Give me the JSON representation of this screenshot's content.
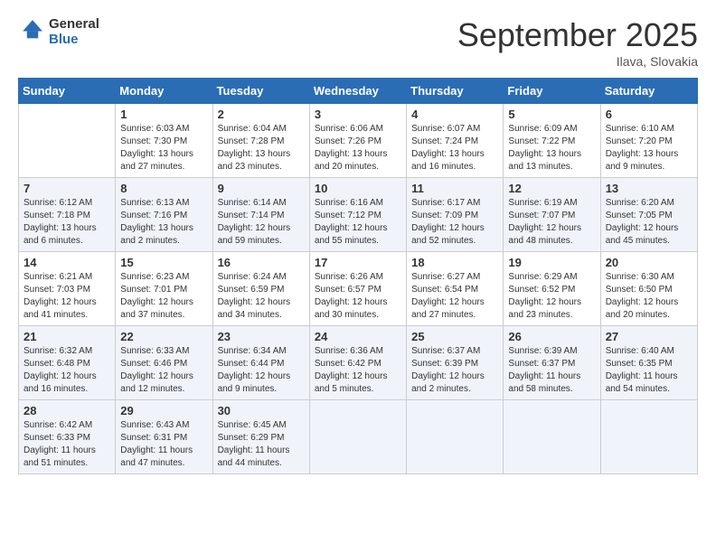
{
  "logo": {
    "text_general": "General",
    "text_blue": "Blue"
  },
  "header": {
    "month": "September 2025",
    "location": "Ilava, Slovakia"
  },
  "weekdays": [
    "Sunday",
    "Monday",
    "Tuesday",
    "Wednesday",
    "Thursday",
    "Friday",
    "Saturday"
  ],
  "weeks": [
    [
      {
        "day": "",
        "sunrise": "",
        "sunset": "",
        "daylight": ""
      },
      {
        "day": "1",
        "sunrise": "Sunrise: 6:03 AM",
        "sunset": "Sunset: 7:30 PM",
        "daylight": "Daylight: 13 hours and 27 minutes."
      },
      {
        "day": "2",
        "sunrise": "Sunrise: 6:04 AM",
        "sunset": "Sunset: 7:28 PM",
        "daylight": "Daylight: 13 hours and 23 minutes."
      },
      {
        "day": "3",
        "sunrise": "Sunrise: 6:06 AM",
        "sunset": "Sunset: 7:26 PM",
        "daylight": "Daylight: 13 hours and 20 minutes."
      },
      {
        "day": "4",
        "sunrise": "Sunrise: 6:07 AM",
        "sunset": "Sunset: 7:24 PM",
        "daylight": "Daylight: 13 hours and 16 minutes."
      },
      {
        "day": "5",
        "sunrise": "Sunrise: 6:09 AM",
        "sunset": "Sunset: 7:22 PM",
        "daylight": "Daylight: 13 hours and 13 minutes."
      },
      {
        "day": "6",
        "sunrise": "Sunrise: 6:10 AM",
        "sunset": "Sunset: 7:20 PM",
        "daylight": "Daylight: 13 hours and 9 minutes."
      }
    ],
    [
      {
        "day": "7",
        "sunrise": "Sunrise: 6:12 AM",
        "sunset": "Sunset: 7:18 PM",
        "daylight": "Daylight: 13 hours and 6 minutes."
      },
      {
        "day": "8",
        "sunrise": "Sunrise: 6:13 AM",
        "sunset": "Sunset: 7:16 PM",
        "daylight": "Daylight: 13 hours and 2 minutes."
      },
      {
        "day": "9",
        "sunrise": "Sunrise: 6:14 AM",
        "sunset": "Sunset: 7:14 PM",
        "daylight": "Daylight: 12 hours and 59 minutes."
      },
      {
        "day": "10",
        "sunrise": "Sunrise: 6:16 AM",
        "sunset": "Sunset: 7:12 PM",
        "daylight": "Daylight: 12 hours and 55 minutes."
      },
      {
        "day": "11",
        "sunrise": "Sunrise: 6:17 AM",
        "sunset": "Sunset: 7:09 PM",
        "daylight": "Daylight: 12 hours and 52 minutes."
      },
      {
        "day": "12",
        "sunrise": "Sunrise: 6:19 AM",
        "sunset": "Sunset: 7:07 PM",
        "daylight": "Daylight: 12 hours and 48 minutes."
      },
      {
        "day": "13",
        "sunrise": "Sunrise: 6:20 AM",
        "sunset": "Sunset: 7:05 PM",
        "daylight": "Daylight: 12 hours and 45 minutes."
      }
    ],
    [
      {
        "day": "14",
        "sunrise": "Sunrise: 6:21 AM",
        "sunset": "Sunset: 7:03 PM",
        "daylight": "Daylight: 12 hours and 41 minutes."
      },
      {
        "day": "15",
        "sunrise": "Sunrise: 6:23 AM",
        "sunset": "Sunset: 7:01 PM",
        "daylight": "Daylight: 12 hours and 37 minutes."
      },
      {
        "day": "16",
        "sunrise": "Sunrise: 6:24 AM",
        "sunset": "Sunset: 6:59 PM",
        "daylight": "Daylight: 12 hours and 34 minutes."
      },
      {
        "day": "17",
        "sunrise": "Sunrise: 6:26 AM",
        "sunset": "Sunset: 6:57 PM",
        "daylight": "Daylight: 12 hours and 30 minutes."
      },
      {
        "day": "18",
        "sunrise": "Sunrise: 6:27 AM",
        "sunset": "Sunset: 6:54 PM",
        "daylight": "Daylight: 12 hours and 27 minutes."
      },
      {
        "day": "19",
        "sunrise": "Sunrise: 6:29 AM",
        "sunset": "Sunset: 6:52 PM",
        "daylight": "Daylight: 12 hours and 23 minutes."
      },
      {
        "day": "20",
        "sunrise": "Sunrise: 6:30 AM",
        "sunset": "Sunset: 6:50 PM",
        "daylight": "Daylight: 12 hours and 20 minutes."
      }
    ],
    [
      {
        "day": "21",
        "sunrise": "Sunrise: 6:32 AM",
        "sunset": "Sunset: 6:48 PM",
        "daylight": "Daylight: 12 hours and 16 minutes."
      },
      {
        "day": "22",
        "sunrise": "Sunrise: 6:33 AM",
        "sunset": "Sunset: 6:46 PM",
        "daylight": "Daylight: 12 hours and 12 minutes."
      },
      {
        "day": "23",
        "sunrise": "Sunrise: 6:34 AM",
        "sunset": "Sunset: 6:44 PM",
        "daylight": "Daylight: 12 hours and 9 minutes."
      },
      {
        "day": "24",
        "sunrise": "Sunrise: 6:36 AM",
        "sunset": "Sunset: 6:42 PM",
        "daylight": "Daylight: 12 hours and 5 minutes."
      },
      {
        "day": "25",
        "sunrise": "Sunrise: 6:37 AM",
        "sunset": "Sunset: 6:39 PM",
        "daylight": "Daylight: 12 hours and 2 minutes."
      },
      {
        "day": "26",
        "sunrise": "Sunrise: 6:39 AM",
        "sunset": "Sunset: 6:37 PM",
        "daylight": "Daylight: 11 hours and 58 minutes."
      },
      {
        "day": "27",
        "sunrise": "Sunrise: 6:40 AM",
        "sunset": "Sunset: 6:35 PM",
        "daylight": "Daylight: 11 hours and 54 minutes."
      }
    ],
    [
      {
        "day": "28",
        "sunrise": "Sunrise: 6:42 AM",
        "sunset": "Sunset: 6:33 PM",
        "daylight": "Daylight: 11 hours and 51 minutes."
      },
      {
        "day": "29",
        "sunrise": "Sunrise: 6:43 AM",
        "sunset": "Sunset: 6:31 PM",
        "daylight": "Daylight: 11 hours and 47 minutes."
      },
      {
        "day": "30",
        "sunrise": "Sunrise: 6:45 AM",
        "sunset": "Sunset: 6:29 PM",
        "daylight": "Daylight: 11 hours and 44 minutes."
      },
      {
        "day": "",
        "sunrise": "",
        "sunset": "",
        "daylight": ""
      },
      {
        "day": "",
        "sunrise": "",
        "sunset": "",
        "daylight": ""
      },
      {
        "day": "",
        "sunrise": "",
        "sunset": "",
        "daylight": ""
      },
      {
        "day": "",
        "sunrise": "",
        "sunset": "",
        "daylight": ""
      }
    ]
  ]
}
